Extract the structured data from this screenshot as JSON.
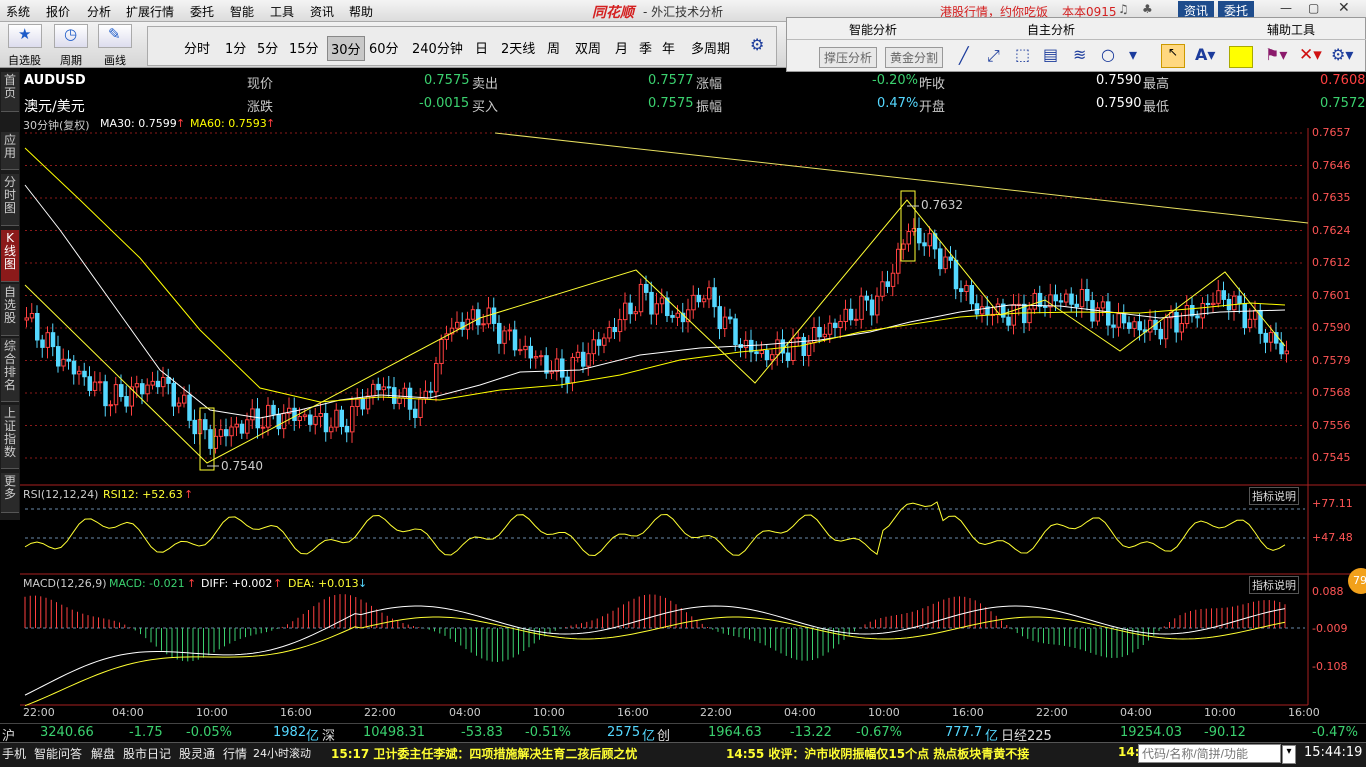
{
  "menu": [
    "系统",
    "报价",
    "分析",
    "扩展行情",
    "委托",
    "智能",
    "工具",
    "资讯",
    "帮助"
  ],
  "brand": "同花顺",
  "window_title": "- 外汇技术分析",
  "top_links": {
    "news": "港股行情，约你吃饭",
    "version": "本本0915",
    "zixun": "资讯",
    "weituo": "委托"
  },
  "toolbar": {
    "buttons": [
      "自选股",
      "周期",
      "画线"
    ],
    "periods": [
      "分时",
      "1分",
      "5分",
      "15分",
      "30分",
      "60分",
      "240分钟",
      "日",
      "2天线",
      "周",
      "双周",
      "月",
      "季",
      "年",
      "多周期"
    ],
    "selected_period": "30分"
  },
  "analysis_panel": {
    "smart": "智能分析",
    "self": "自主分析",
    "aux": "辅助工具",
    "support_btn": "撑压分析",
    "golden_btn": "黄金分割"
  },
  "leftnav": [
    "首页",
    "应用",
    "分时图",
    "K线图",
    "自选股",
    "综合排名",
    "上证指数",
    "更多"
  ],
  "leftnav_active": "K线图",
  "quote": {
    "code": "AUDUSD",
    "name": "澳元/美元",
    "price_label": "现价",
    "price": "0.7575",
    "change_label": "涨跌",
    "change": "-0.0015",
    "sell_label": "卖出",
    "sell": "0.7577",
    "buy_label": "买入",
    "buy": "0.7575",
    "pct_label": "涨幅",
    "pct": "-0.20%",
    "amp_label": "振幅",
    "amp": "0.47%",
    "prev_label": "昨收",
    "prev": "0.7590",
    "open_label": "开盘",
    "open": "0.7590",
    "high_label": "最高",
    "high": "0.7608",
    "low_label": "最低",
    "low": "0.7572"
  },
  "ma_legend": {
    "period": "30分钟(复权)",
    "ma30": "MA30: 0.7599",
    "ma60": "MA60: 0.7593"
  },
  "price_axis": [
    "0.7657",
    "0.7646",
    "0.7635",
    "0.7624",
    "0.7612",
    "0.7601",
    "0.7590",
    "0.7579",
    "0.7568",
    "0.7556",
    "0.7545"
  ],
  "annotations": {
    "high": "0.7632",
    "low": "0.7540"
  },
  "rsi": {
    "legend": "RSI(12,12,24)",
    "value": "RSI12: +52.63",
    "axis": [
      "+77.11",
      "+47.48"
    ],
    "help": "指标说明"
  },
  "macd": {
    "legend": "MACD(12,26,9)",
    "macd": "MACD: -0.021",
    "diff": "DIFF: +0.002",
    "dea": "DEA: +0.013",
    "axis": [
      "0.088",
      "-0.009",
      "-0.108"
    ],
    "help": "指标说明"
  },
  "time_axis": [
    "22:00",
    "04:00",
    "10:00",
    "16:00",
    "22:00",
    "04:00",
    "10:00",
    "16:00",
    "22:00",
    "04:00",
    "10:00",
    "16:00",
    "22:00",
    "04:00",
    "10:00",
    "16:00"
  ],
  "ticker": {
    "sh_label": "沪",
    "sh_index": "3240.66",
    "sh_chg": "-1.75",
    "sh_pct": "-0.05%",
    "sh_amt": "1982",
    "yi1": "亿",
    "sz_label": "深",
    "sz_index": "10498.31",
    "sz_chg": "-53.83",
    "sz_pct": "-0.51%",
    "sz_amt": "2575",
    "yi2": "亿",
    "cy_label": "创",
    "cy_index": "1964.63",
    "cy_chg": "-13.22",
    "cy_pct": "-0.67%",
    "cy_amt": "777.7",
    "yi3": "亿",
    "nk_label": "日经225",
    "nk_index": "19254.03",
    "nk_chg": "-90.12",
    "nk_pct": "-0.47%"
  },
  "status": {
    "tabs": [
      "手机",
      "智能问答",
      "解盘",
      "股市日记",
      "股灵通",
      "行情",
      "24小时滚动"
    ],
    "news1": "15:17 卫计委主任李斌：四项措施解决生育二孩后顾之忧",
    "news2": "14:55 收评：沪市收阴振幅仅15个点 热点板块青黄不接",
    "news3": "14:",
    "search_placeholder": "代码/名称/简拼/功能",
    "clock": "15:44:19"
  },
  "badge": "79",
  "colors": {
    "up": "#ff4040",
    "down": "#3bd16f",
    "ma30": "#ffffff",
    "ma60": "#ffff00",
    "grid": "#8a1a1a"
  }
}
